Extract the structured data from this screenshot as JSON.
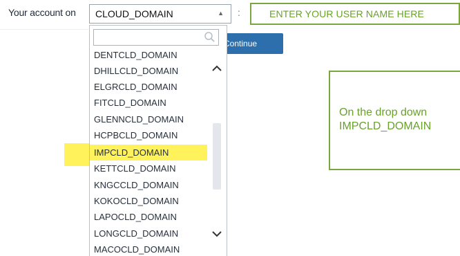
{
  "login": {
    "account_label": "Your account on",
    "selected_domain": "CLOUD_DOMAIN",
    "colon": ":",
    "continue_label": "Continue"
  },
  "username_callout": {
    "text": "ENTER YOUR USER NAME HERE"
  },
  "dropdown": {
    "search_placeholder": "",
    "items": [
      "DENTCLD_DOMAIN",
      "DHILLCLD_DOMAIN",
      "ELGRCLD_DOMAIN",
      "FITCLD_DOMAIN",
      "GLENNCLD_DOMAIN",
      "HCPBCLD_DOMAIN",
      "IMPCLD_DOMAIN",
      "KETTCLD_DOMAIN",
      "KNGCCLD_DOMAIN",
      "KOKOCLD_DOMAIN",
      "LAPOCLD_DOMAIN",
      "LONGCLD_DOMAIN",
      "MACOCLD_DOMAIN"
    ],
    "highlighted_item": "IMPCLD_DOMAIN",
    "highlight_color": "#fff25a"
  },
  "instruction_callout": {
    "line1": "On the drop down",
    "line2": "IMPCLD_DOMAIN"
  },
  "colors": {
    "callout_border": "#78a83a",
    "callout_text": "#6aa02c",
    "button_bg": "#2d6fad"
  }
}
